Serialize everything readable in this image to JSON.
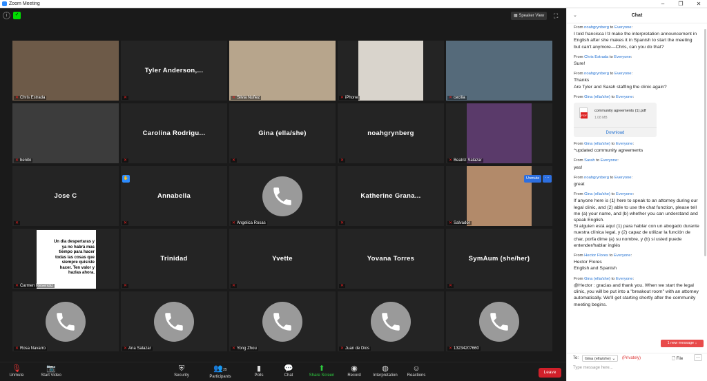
{
  "window": {
    "title": "Zoom Meeting",
    "controls": [
      "–",
      "❐",
      "✕"
    ]
  },
  "top": {
    "speaker_view_label": "Speaker View"
  },
  "tiles": [
    {
      "label": "Chris Estrada",
      "display": "",
      "kind": "video",
      "active": true
    },
    {
      "label": "",
      "display": "Tyler  Anderson,...",
      "kind": "name"
    },
    {
      "label": "Silvia Nuñez",
      "display": "",
      "kind": "video"
    },
    {
      "label": "iPhone",
      "display": "",
      "kind": "video"
    },
    {
      "label": "cecilia",
      "display": "",
      "kind": "video"
    },
    {
      "label": "benito",
      "display": "",
      "kind": "video"
    },
    {
      "label": "",
      "display": "Carolina  Rodrigu...",
      "kind": "name"
    },
    {
      "label": "",
      "display": "Gina (ella/she)",
      "kind": "name"
    },
    {
      "label": "",
      "display": "noahgrynberg",
      "kind": "name"
    },
    {
      "label": "Beatriz Salazar",
      "display": "",
      "kind": "video"
    },
    {
      "label": "",
      "display": "Jose C",
      "kind": "name"
    },
    {
      "label": "",
      "display": "Annabella",
      "kind": "name"
    },
    {
      "label": "Angelica Rosas",
      "display": "",
      "kind": "phone"
    },
    {
      "label": "",
      "display": "Katherine  Grana...",
      "kind": "name"
    },
    {
      "label": "Salvador",
      "display": "",
      "kind": "video"
    },
    {
      "label": "Carmen Resendiz",
      "display": "",
      "kind": "video"
    },
    {
      "label": "",
      "display": "Trinidad",
      "kind": "name"
    },
    {
      "label": "",
      "display": "Yvette",
      "kind": "name"
    },
    {
      "label": "",
      "display": "Yovana Torres",
      "kind": "name"
    },
    {
      "label": "",
      "display": "SymAum (she/her)",
      "kind": "name"
    },
    {
      "label": "Rosa Navarro",
      "display": "",
      "kind": "phone"
    },
    {
      "label": "Ana Salazar",
      "display": "",
      "kind": "phone"
    },
    {
      "label": "Yong Zhou",
      "display": "",
      "kind": "phone"
    },
    {
      "label": "Juan de Dios",
      "display": "",
      "kind": "phone"
    },
    {
      "label": "13234207660",
      "display": "",
      "kind": "phone"
    }
  ],
  "poster_text": "Un dia despertaras y ya no habrá mas tiempo para hacer todas las cosas que siempre quisiste hacer. Ten valor y hazlas ahora.",
  "unmute_label": "Unmute",
  "toolbar": {
    "unmute": "Unmute",
    "start_video": "Start Video",
    "security": "Security",
    "participants": "Participants",
    "participants_count": "25",
    "polls": "Polls",
    "chat": "Chat",
    "share_screen": "Share Screen",
    "record": "Record",
    "interpretation": "Interpretation",
    "reactions": "Reactions",
    "leave": "Leave"
  },
  "chat": {
    "title": "Chat",
    "messages": [
      {
        "from": "noahgrynberg",
        "to": "Everyone",
        "text": "I told francisca I'd make the interpretation announcement in English after she makes it in Spanish to start the meeting\nbut can't anymore—Chris, can you do that?"
      },
      {
        "from": "Chris Estrada",
        "to": "Everyone",
        "text": "Sure!"
      },
      {
        "from": "noahgrynberg",
        "to": "Everyone",
        "text": "Thanks\nAre Tyler and Sarah staffing the clinic again?"
      },
      {
        "from": "Gina (ella/she)",
        "to": "Everyone",
        "text": ""
      },
      {
        "from": "Gina (ella/she)",
        "to": "Everyone",
        "text": "^updated community agreements"
      },
      {
        "from": "Sarah",
        "to": "Everyone",
        "text": "yes!"
      },
      {
        "from": "noahgrynberg",
        "to": "Everyone",
        "text": "great"
      },
      {
        "from": "Gina (ella/she)",
        "to": "Everyone",
        "text": "If anyone here is (1) here to speak to an attorney during our legal clinic, and (2) able to use the chat function, please tell me (a) your name, and (b) whether you can understand and speak English.\nSi alguien está aquí (1) para hablar con un abogado durante nuestra clínica legal, y (2) capaz de utilizar la función de char, porfa dime (a) su nombre, y (b) si usted puede entender/hablar inglés"
      },
      {
        "from": "Hector Flores",
        "to": "Everyone",
        "text": "Hector Flores\nEnglish and Spanish"
      },
      {
        "from": "Gina (ella/she)",
        "to": "Everyone",
        "text": "@Hector : gracias and thank you. When we start the legal clinic, you will be put into a \"breakout room\" with an attorney automatically. We'll get starting shortly after the community meeting begins."
      }
    ],
    "from_word": "From",
    "to_word": "to",
    "file": {
      "name": "community agreements (1).pdf",
      "size": "1.08 MB",
      "download": "Download",
      "type": "PDF"
    },
    "new_message": "1 new message ↓",
    "to_label": "To:",
    "to_value": "Gina (ella/she)",
    "privately": "(Privately)",
    "file_button": "File",
    "placeholder": "Type message here..."
  }
}
